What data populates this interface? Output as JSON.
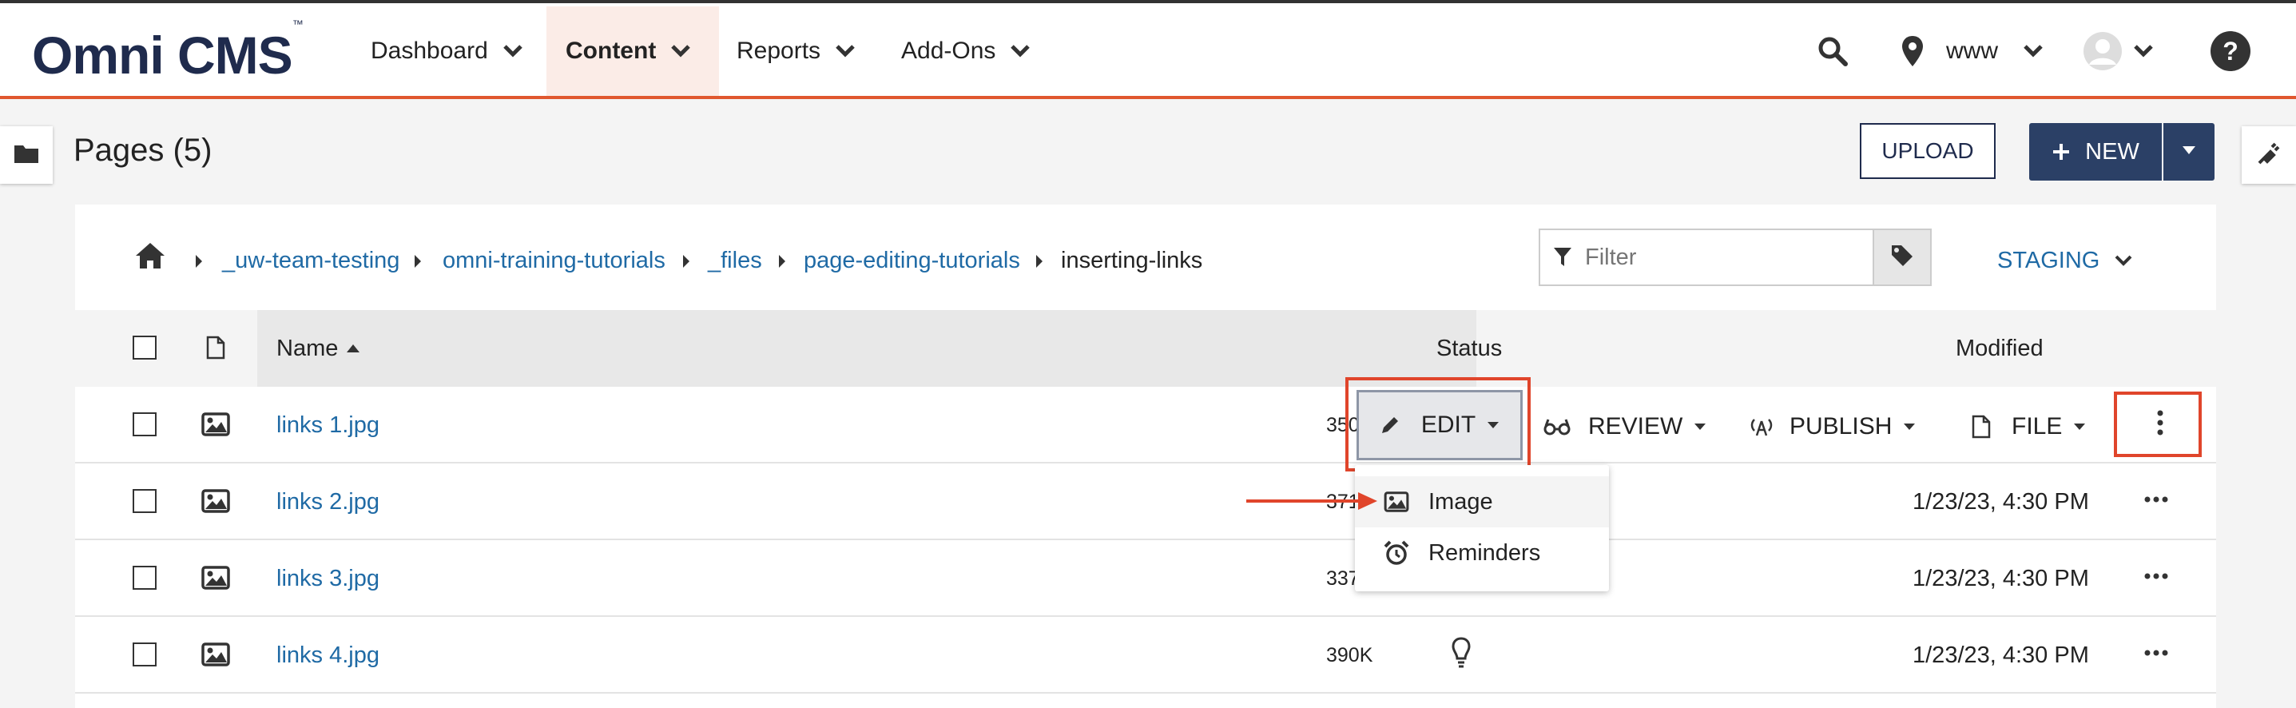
{
  "header": {
    "logo": "Omni CMS",
    "logo_tm": "™",
    "nav": [
      {
        "label": "Dashboard"
      },
      {
        "label": "Content"
      },
      {
        "label": "Reports"
      },
      {
        "label": "Add-Ons"
      }
    ],
    "site": "www"
  },
  "toolbar": {
    "page_title": "Pages (5)",
    "upload_label": "UPLOAD",
    "new_label": "NEW"
  },
  "breadcrumb": {
    "items": [
      "_uw-team-testing",
      "omni-training-tutorials",
      "_files",
      "page-editing-tutorials",
      "inserting-links"
    ]
  },
  "filter": {
    "placeholder": "Filter"
  },
  "staging_label": "STAGING",
  "table": {
    "headers": {
      "name": "Name",
      "status": "Status",
      "modified": "Modified"
    },
    "rows": [
      {
        "name": "links 1.jpg",
        "size": "350",
        "modified": ""
      },
      {
        "name": "links 2.jpg",
        "size": "371",
        "modified": "1/23/23, 4:30 PM"
      },
      {
        "name": "links 3.jpg",
        "size": "337",
        "modified": "1/23/23, 4:30 PM"
      },
      {
        "name": "links 4.jpg",
        "size": "390K",
        "modified": "1/23/23, 4:30 PM"
      }
    ]
  },
  "actions": {
    "edit": "EDIT",
    "review": "REVIEW",
    "publish": "PUBLISH",
    "file": "FILE"
  },
  "edit_menu": {
    "items": [
      {
        "label": "Image",
        "icon": "image-icon"
      },
      {
        "label": "Reminders",
        "icon": "alarm-clock-icon"
      }
    ]
  },
  "colors": {
    "accent": "#e0572e",
    "brand_navy": "#1f2b4d",
    "link": "#1f6aa5",
    "annotation_red": "#e0452b"
  }
}
